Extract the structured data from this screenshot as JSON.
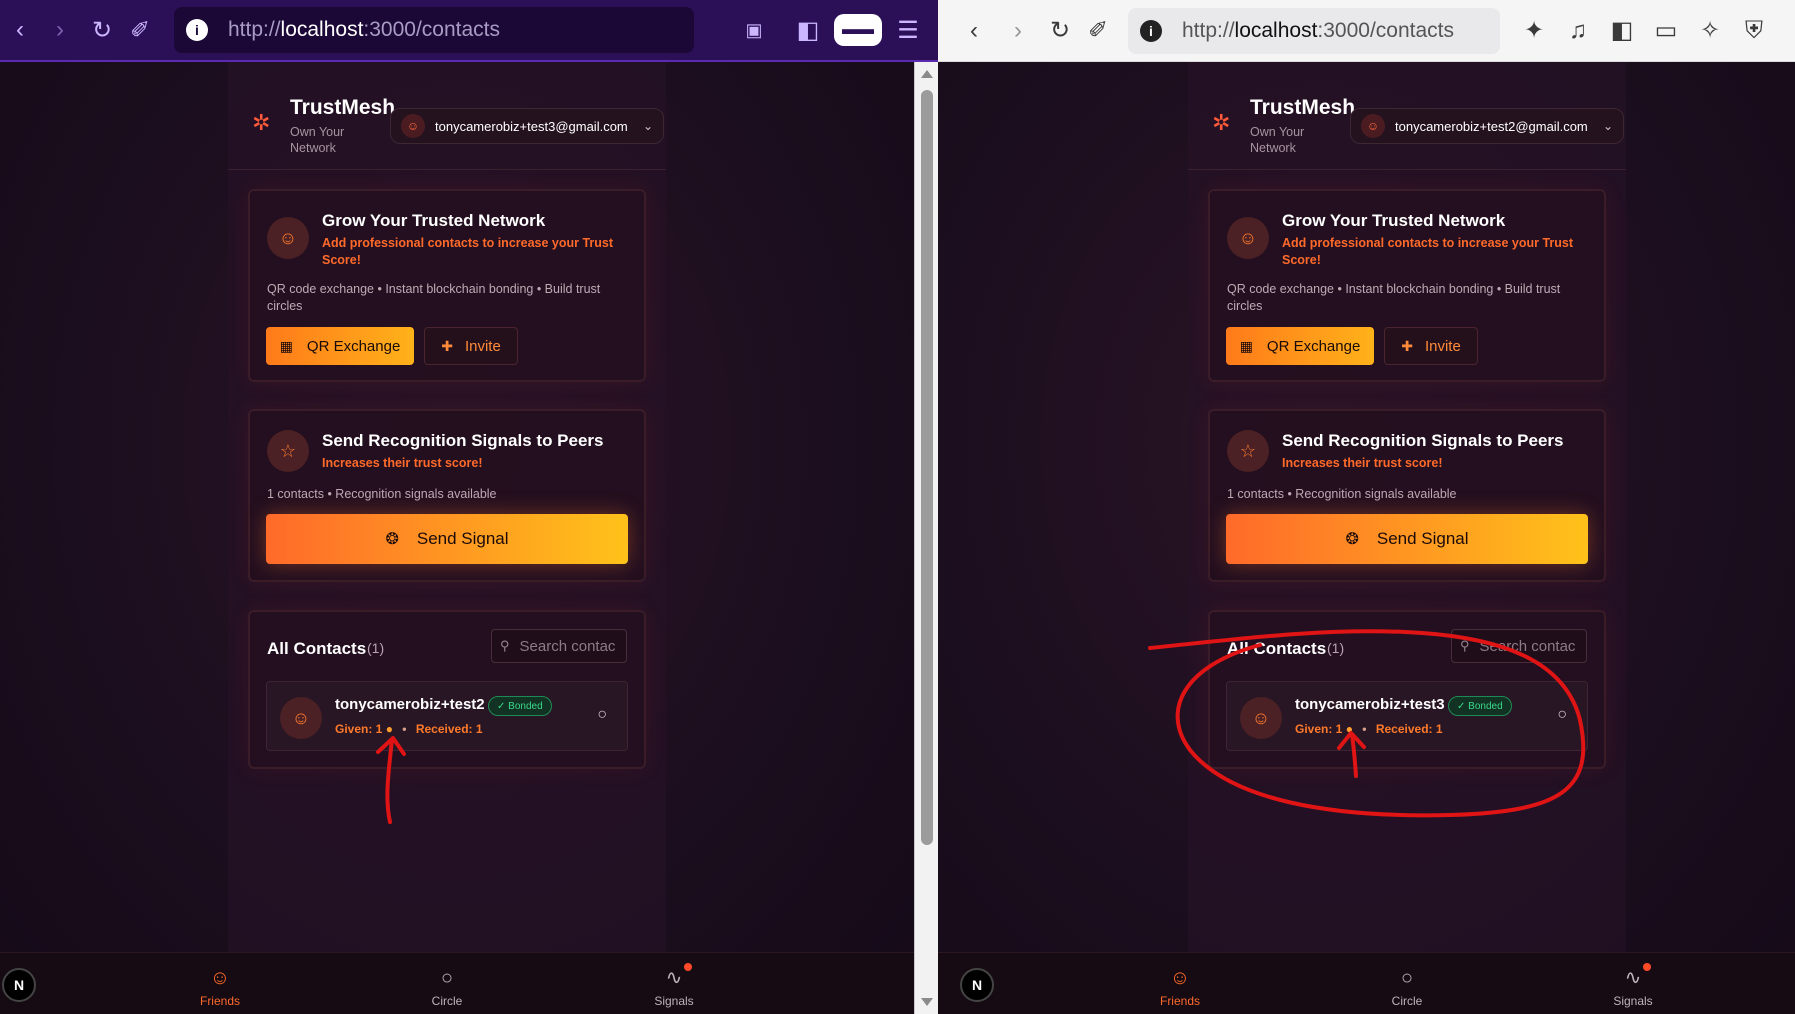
{
  "panes": [
    {
      "url_scheme": "http://",
      "url_host": "localhost",
      "url_rest": ":3000/contacts",
      "app": {
        "brand": "TrustMesh",
        "tagline": "Own Your Network",
        "account_email": "tonycamerobiz+test3@gmail.com",
        "grow": {
          "title": "Grow Your Trusted Network",
          "subtitle": "Add professional contacts to increase your Trust Score!",
          "desc": "QR code exchange • Instant blockchain bonding • Build trust circles",
          "qr_label": "QR Exchange",
          "invite_label": "Invite"
        },
        "signals": {
          "title": "Send Recognition Signals to Peers",
          "subtitle": "Increases their trust score!",
          "desc": "1 contacts • Recognition signals available",
          "button_label": "Send Signal"
        },
        "contacts": {
          "title": "All Contacts",
          "count": "(1)",
          "search_placeholder": "Search contac",
          "item": {
            "name": "tonycamerobiz+test2",
            "badge": "✓ Bonded",
            "given": "Given: 1",
            "received": "Received: 1"
          }
        },
        "nav": {
          "friends": "Friends",
          "circle": "Circle",
          "signals": "Signals"
        }
      }
    },
    {
      "url_scheme": "http://",
      "url_host": "localhost",
      "url_rest": ":3000/contacts",
      "app": {
        "brand": "TrustMesh",
        "tagline": "Own Your Network",
        "account_email": "tonycamerobiz+test2@gmail.com",
        "grow": {
          "title": "Grow Your Trusted Network",
          "subtitle": "Add professional contacts to increase your Trust Score!",
          "desc": "QR code exchange • Instant blockchain bonding • Build trust circles",
          "qr_label": "QR Exchange",
          "invite_label": "Invite"
        },
        "signals": {
          "title": "Send Recognition Signals to Peers",
          "subtitle": "Increases their trust score!",
          "desc": "1 contacts • Recognition signals available",
          "button_label": "Send Signal"
        },
        "contacts": {
          "title": "All Contacts",
          "count": "(1)",
          "search_placeholder": "Search contac",
          "item": {
            "name": "tonycamerobiz+test3",
            "badge": "✓ Bonded",
            "given": "Given: 1",
            "received": "Received: 1"
          }
        },
        "nav": {
          "friends": "Friends",
          "circle": "Circle",
          "signals": "Signals"
        }
      }
    }
  ],
  "colors": {
    "accent": "#ff6a2a",
    "gradient_start": "#ff7a1a",
    "gradient_end": "#ffb21a",
    "bonded": "#3ad88a",
    "annotation": "#e01414"
  }
}
